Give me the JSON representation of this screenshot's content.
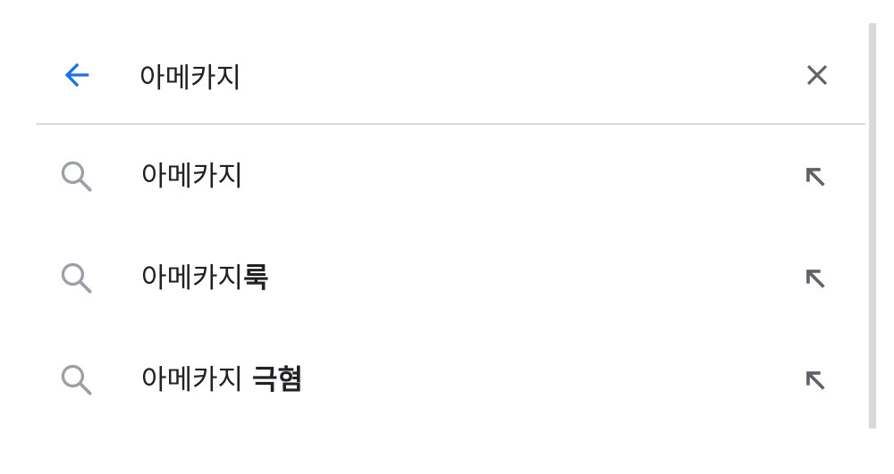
{
  "search": {
    "query": "아메카지",
    "back_icon": "arrow-back-icon",
    "clear_icon": "close-icon"
  },
  "suggestions": [
    {
      "prefix": "아메카지",
      "completion": "",
      "icon": "search-icon",
      "action_icon": "arrow-up-left-icon"
    },
    {
      "prefix": "아메카지",
      "completion": "룩",
      "icon": "search-icon",
      "action_icon": "arrow-up-left-icon"
    },
    {
      "prefix": "아메카지 ",
      "completion": "극혐",
      "icon": "search-icon",
      "action_icon": "arrow-up-left-icon"
    }
  ],
  "colors": {
    "accent": "#1a73e8",
    "icon_gray": "#9aa0a6",
    "text": "#202124",
    "divider": "#dadce0",
    "scrollbar": "#d9d9d9"
  }
}
